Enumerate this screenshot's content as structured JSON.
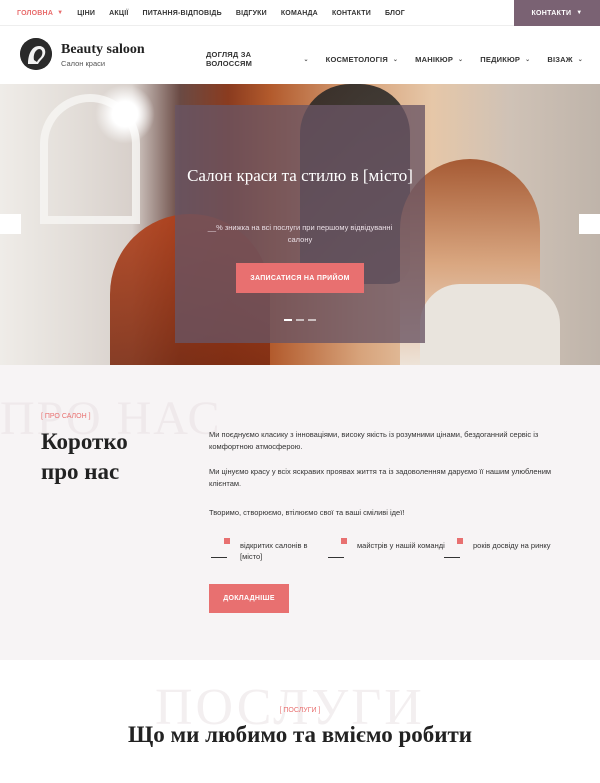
{
  "topbar": {
    "nav": [
      {
        "label": "ГОЛОВНА",
        "active": true,
        "has_caret": true
      },
      {
        "label": "ЦІНИ"
      },
      {
        "label": "АКЦІЇ"
      },
      {
        "label": "ПИТАННЯ-ВІДПОВІДЬ"
      },
      {
        "label": "ВІДГУКИ"
      },
      {
        "label": "КОМАНДА"
      },
      {
        "label": "КОНТАКТИ"
      },
      {
        "label": "БЛОГ"
      }
    ],
    "contacts_button": "КОНТАКТИ",
    "caret_icon": "chevron-down-icon"
  },
  "header": {
    "logo_title": "Beauty saloon",
    "logo_subtitle": "Салон краси",
    "nav": [
      {
        "label": "ДОГЛЯД ЗА ВОЛОССЯМ"
      },
      {
        "label": "КОСМЕТОЛОГІЯ"
      },
      {
        "label": "МАНІКЮР"
      },
      {
        "label": "ПЕДИКЮР"
      },
      {
        "label": "ВІЗАЖ"
      }
    ]
  },
  "hero": {
    "title": "Салон краси та стилю в [місто]",
    "description": "__% знижка на всі послуги при першому відвідуванні салону",
    "button": "ЗАПИСАТИСЯ НА ПРИЙОМ",
    "slides": 3,
    "active_slide": 1
  },
  "about": {
    "bg_word": "ПРО НАС",
    "tag": "[ ПРО САЛОН ]",
    "heading_line1": "Коротко",
    "heading_line2": "про нас",
    "paragraphs": [
      "Ми поєднуємо класику з інноваціями, високу якість із розумними цінами, бездоганний сервіс із комфортною атмосферою.",
      "Ми цінуємо красу у всіх яскравих проявах життя та із задоволенням даруємо її нашим улюбленим клієнтам.",
      "Творимо, створюємо, втілюємо свої та ваші сміливі ідеї!"
    ],
    "stats": [
      {
        "label": "відкритих салонів в [місто]"
      },
      {
        "label": "майстрів у нашій команді"
      },
      {
        "label": "років досвіду на ринку"
      }
    ],
    "button": "ДОКЛАДНІШЕ"
  },
  "services": {
    "bg_word": "ПОСЛУГИ",
    "tag": "[ ПОСЛУГИ ]",
    "heading": "Що ми любимо та вміємо робити"
  },
  "colors": {
    "accent": "#e87070",
    "mauve": "#7a6273",
    "overlay": "#695464",
    "section_bg": "#f7f4f5"
  }
}
